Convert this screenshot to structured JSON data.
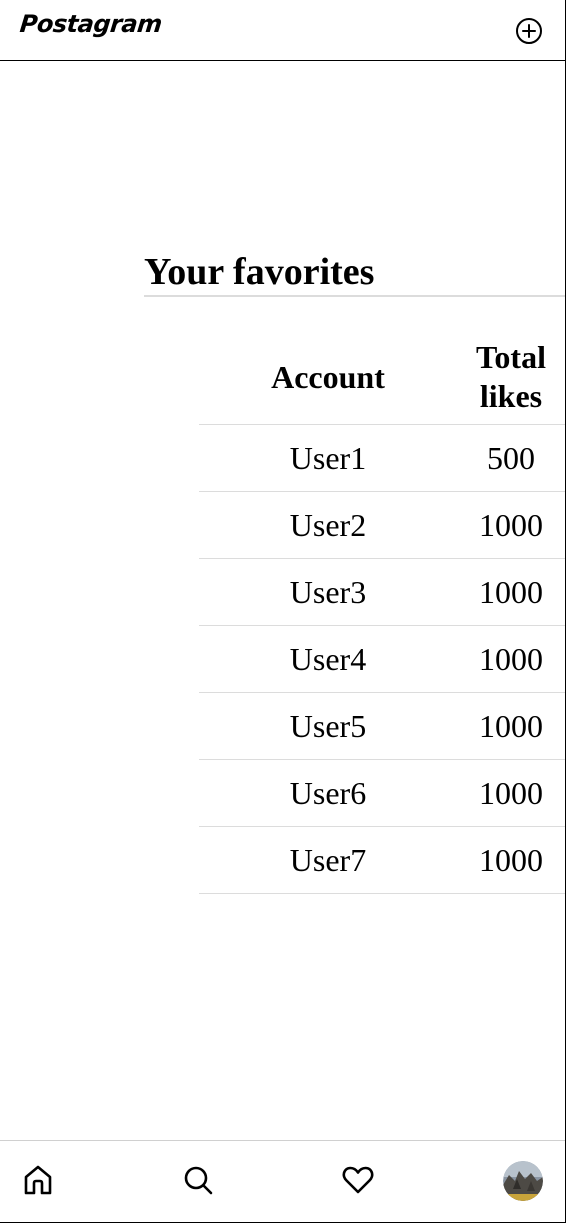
{
  "header": {
    "brand": "Postagram"
  },
  "main": {
    "title": "Your favorites",
    "table": {
      "columns": [
        "Account",
        "Total likes"
      ],
      "rows": [
        {
          "account": "User1",
          "likes": "500"
        },
        {
          "account": "User2",
          "likes": "1000"
        },
        {
          "account": "User3",
          "likes": "1000"
        },
        {
          "account": "User4",
          "likes": "1000"
        },
        {
          "account": "User5",
          "likes": "1000"
        },
        {
          "account": "User6",
          "likes": "1000"
        },
        {
          "account": "User7",
          "likes": "1000"
        }
      ]
    }
  },
  "bottom_nav": {
    "items": [
      {
        "icon": "home-icon"
      },
      {
        "icon": "search-icon"
      },
      {
        "icon": "heart-icon"
      },
      {
        "icon": "avatar"
      }
    ]
  },
  "colors": {
    "text": "#000000",
    "divider": "#dcdcdc",
    "background": "#ffffff"
  }
}
